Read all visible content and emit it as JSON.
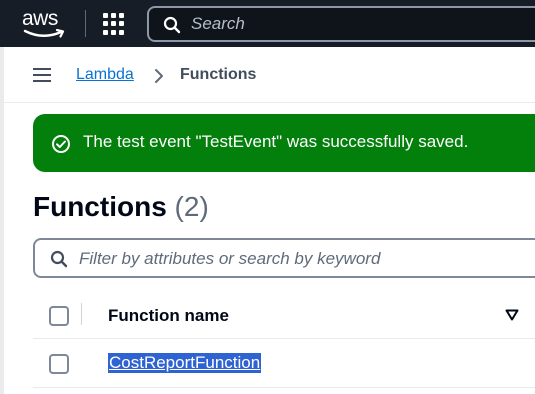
{
  "topnav": {
    "logo_text": "aws",
    "search_placeholder": "Search"
  },
  "breadcrumb": {
    "parent": "Lambda",
    "current": "Functions"
  },
  "flash": {
    "message": "The test event \"TestEvent\" was successfully saved.",
    "color": "#037f0c"
  },
  "page": {
    "title": "Functions",
    "count": "(2)"
  },
  "filter": {
    "placeholder": "Filter by attributes or search by keyword"
  },
  "table": {
    "columns": [
      "Function name"
    ],
    "rows": [
      {
        "function_name": "CostReportFunction",
        "selected_text": true
      }
    ]
  },
  "colors": {
    "topbar": "#161d26",
    "link": "#0972d3",
    "selection": "#2f63d1"
  }
}
